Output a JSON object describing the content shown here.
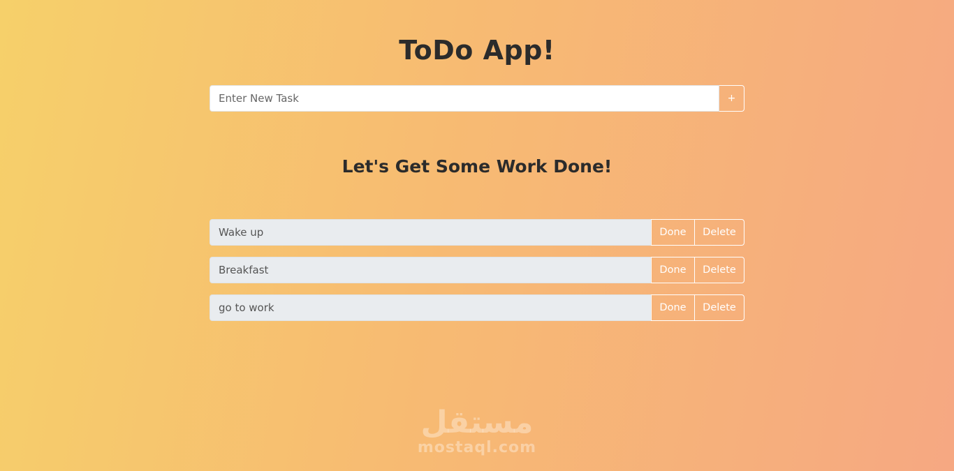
{
  "app": {
    "title": "ToDo App!",
    "subtitle": "Let's Get Some Work Done!"
  },
  "new_task": {
    "placeholder": "Enter New Task",
    "value": "",
    "add_label": "+"
  },
  "tasks": [
    {
      "text": "Wake up",
      "done_label": "Done",
      "delete_label": "Delete"
    },
    {
      "text": "Breakfast",
      "done_label": "Done",
      "delete_label": "Delete"
    },
    {
      "text": "go to work",
      "done_label": "Done",
      "delete_label": "Delete"
    }
  ],
  "watermark": {
    "arabic": "مستقل",
    "latin": "mostaql.com"
  },
  "colors": {
    "gradient_start": "#f6d06a",
    "gradient_end": "#f6a882",
    "task_bg": "#e9ecef",
    "title_text": "#2b2b2b"
  }
}
